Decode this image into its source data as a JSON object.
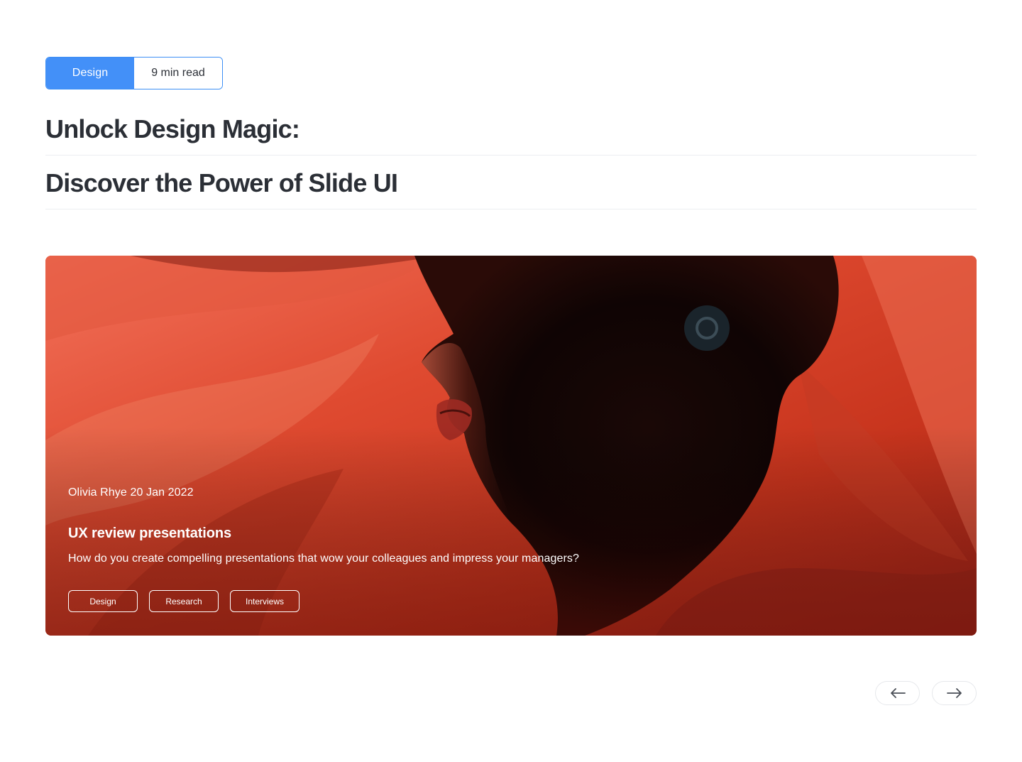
{
  "badge": {
    "category": "Design",
    "read_time": "9 min read"
  },
  "headline": {
    "line1": "Unlock Design Magic:",
    "line2": "Discover the Power of Slide UI"
  },
  "slide": {
    "author_date": "Olivia Rhye 20 Jan 2022",
    "title": "UX review presentations",
    "description": "How do you create compelling presentations that wow your colleagues and impress your managers?",
    "tags": [
      "Design",
      "Research",
      "Interviews"
    ]
  },
  "navigation": {
    "prev_icon": "arrow-left-icon",
    "next_icon": "arrow-right-icon"
  },
  "colors": {
    "accent": "#4390f8",
    "hero_red": "#c7341d",
    "text": "#2b2f36"
  }
}
